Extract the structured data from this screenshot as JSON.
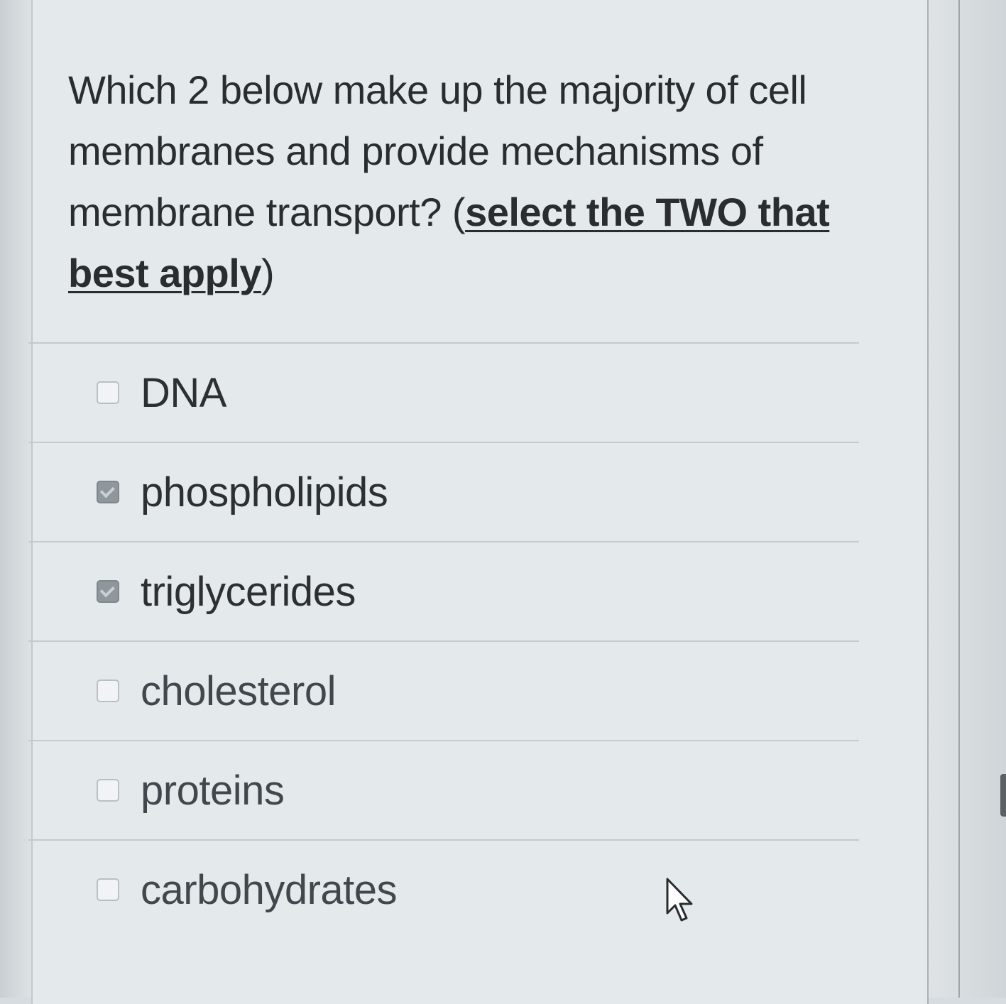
{
  "question": {
    "text_before": "Which 2 below make up the majority of cell membranes and provide mechanisms of membrane transport? (",
    "emphasis": "select the TWO that best apply",
    "text_after": ")"
  },
  "options": [
    {
      "label": "DNA",
      "checked": false
    },
    {
      "label": "phospholipids",
      "checked": true
    },
    {
      "label": "triglycerides",
      "checked": true
    },
    {
      "label": "cholesterol",
      "checked": false
    },
    {
      "label": "proteins",
      "checked": false
    },
    {
      "label": "carbohydrates",
      "checked": false
    }
  ],
  "colors": {
    "panel_background": "#e4e9ec",
    "text": "#2a2d30",
    "checked_box": "#8f979c",
    "divider": "#c3cbd0"
  },
  "icons": {
    "cursor": "mouse-pointer-icon",
    "checkbox_checked": "checkmark-icon"
  }
}
